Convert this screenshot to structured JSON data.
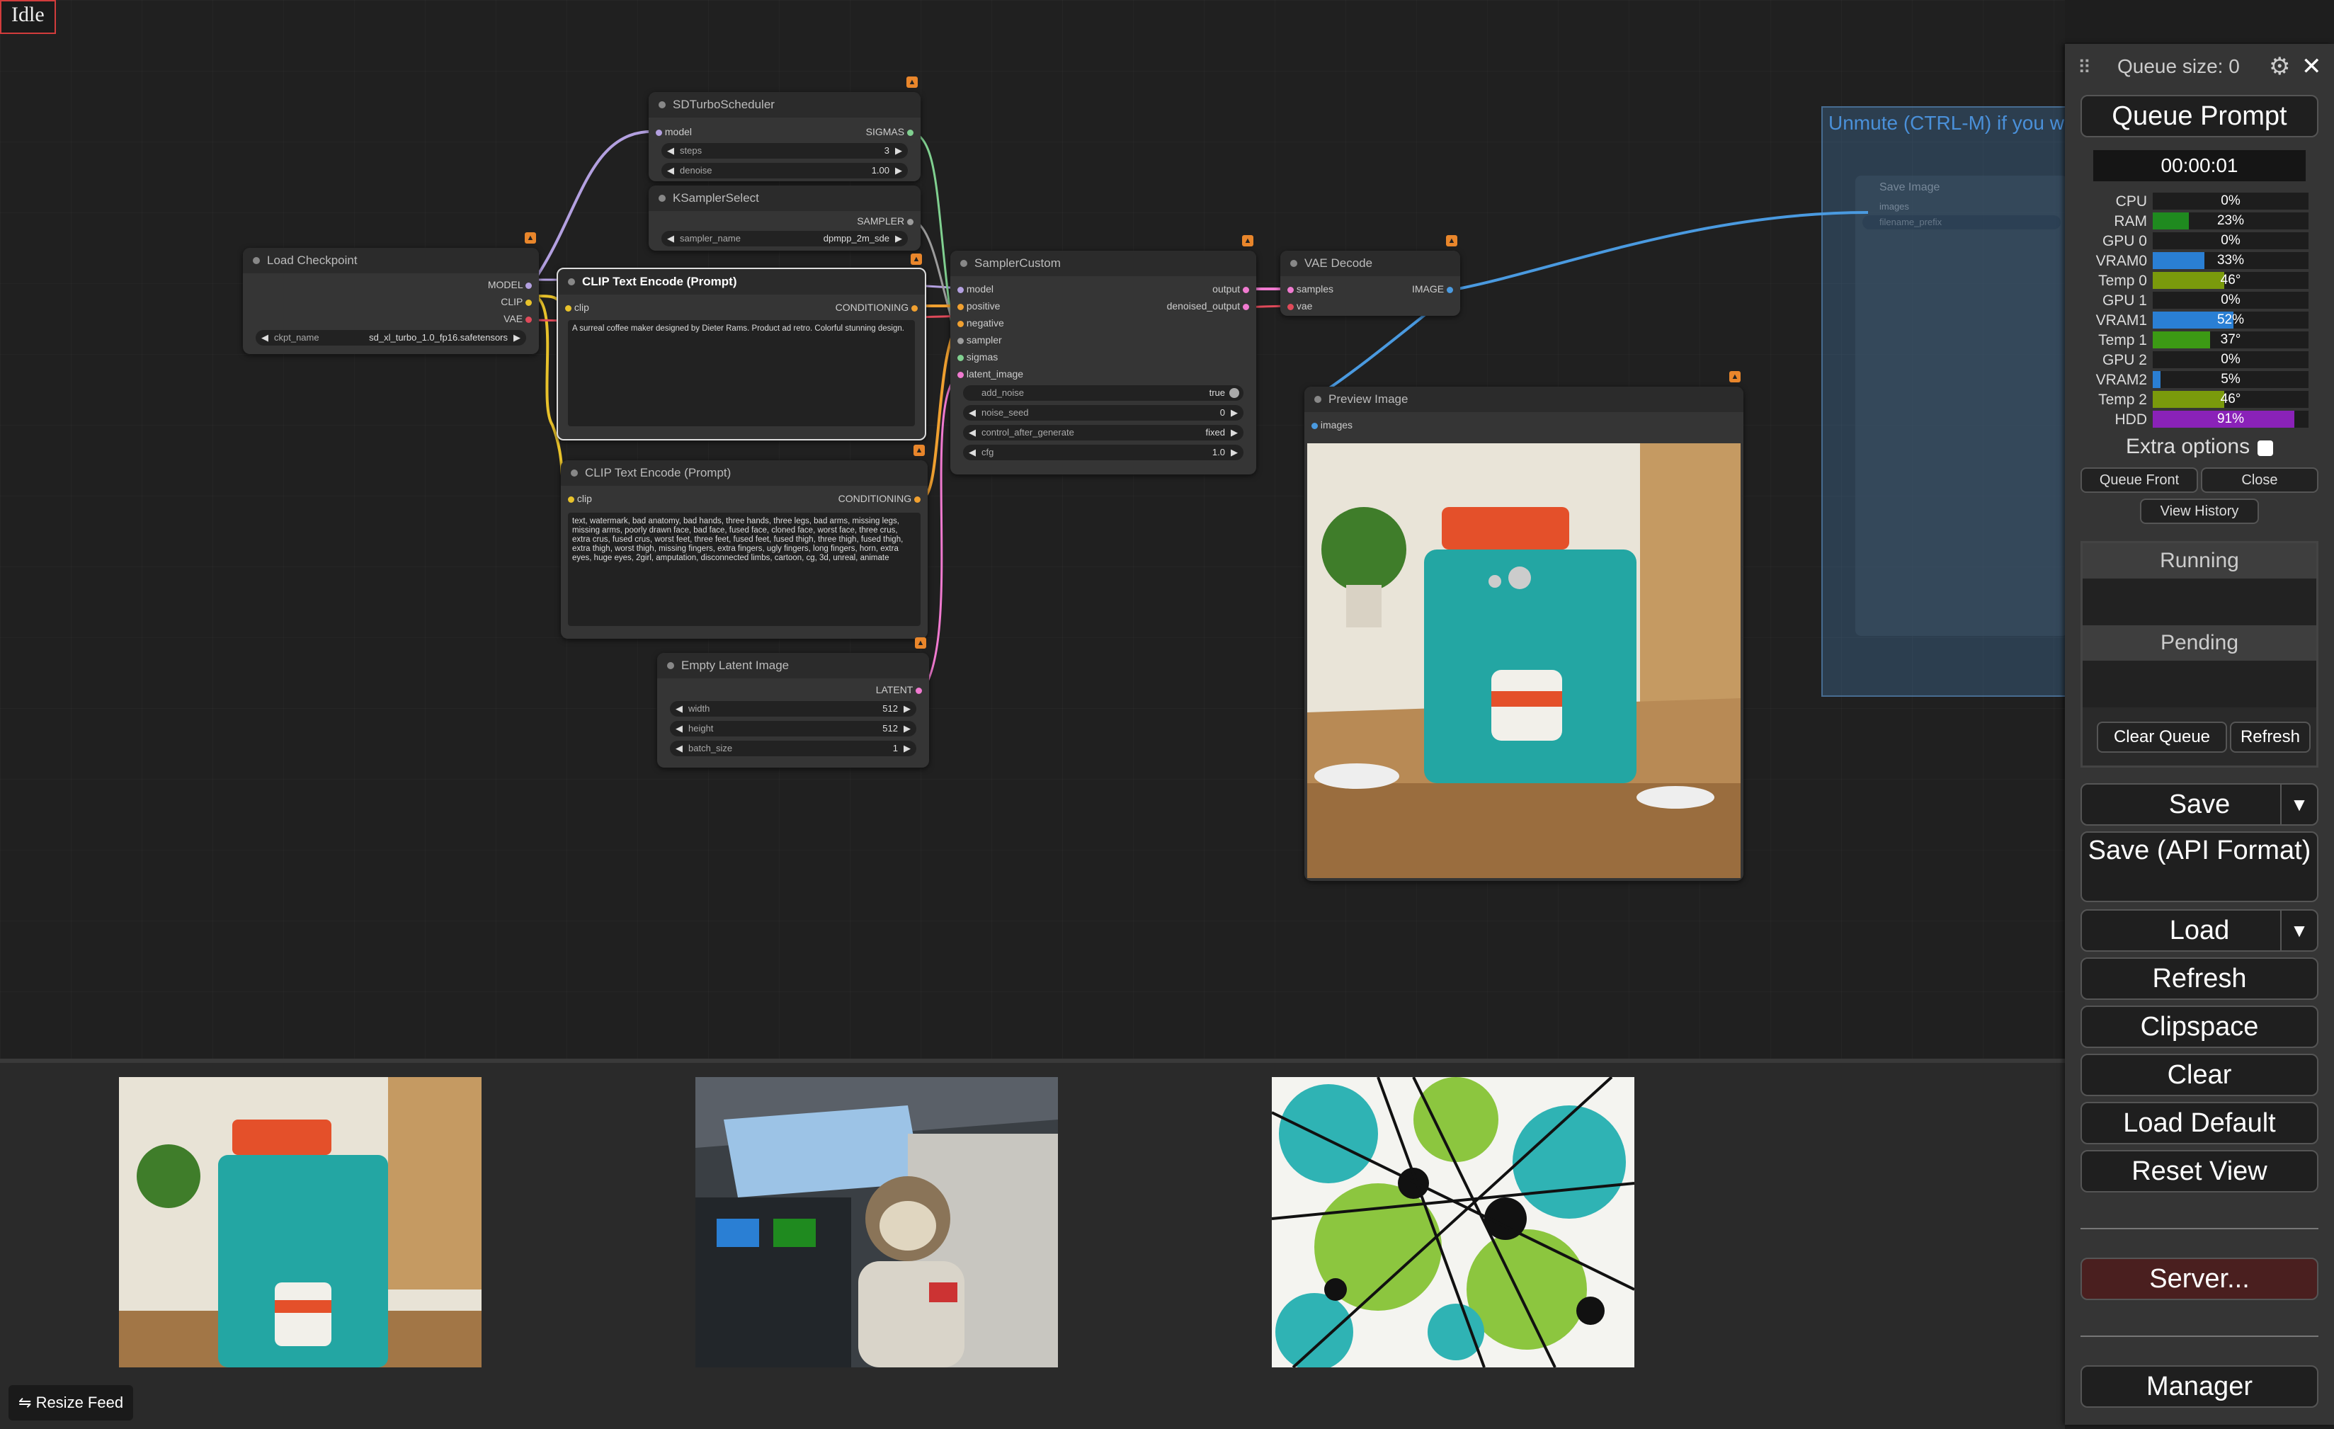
{
  "status": "Idle",
  "graph": {
    "group": {
      "title": "Unmute (CTRL-M) if you w"
    },
    "save_image_node": {
      "title": "Save Image",
      "input": "images",
      "widget": "filename_prefix"
    },
    "load_checkpoint": {
      "title": "Load Checkpoint",
      "outputs": [
        "MODEL",
        "CLIP",
        "VAE"
      ],
      "widget": {
        "label": "ckpt_name",
        "value": "sd_xl_turbo_1.0_fp16.safetensors"
      }
    },
    "sd_turbo_scheduler": {
      "title": "SDTurboScheduler",
      "input": "model",
      "output": "SIGMAS",
      "widgets": [
        {
          "label": "steps",
          "value": "3"
        },
        {
          "label": "denoise",
          "value": "1.00"
        }
      ]
    },
    "ksampler_select": {
      "title": "KSamplerSelect",
      "output": "SAMPLER",
      "widget": {
        "label": "sampler_name",
        "value": "dpmpp_2m_sde"
      }
    },
    "clip_text_pos": {
      "title": "CLIP Text Encode (Prompt)",
      "input": "clip",
      "output": "CONDITIONING",
      "text": "A surreal coffee maker designed by Dieter Rams. Product ad retro. Colorful stunning design."
    },
    "clip_text_neg": {
      "title": "CLIP Text Encode (Prompt)",
      "input": "clip",
      "output": "CONDITIONING",
      "text": "text, watermark, bad anatomy, bad hands, three hands, three legs, bad arms, missing legs, missing arms, poorly drawn face, bad face, fused face, cloned face, worst face, three crus, extra crus, fused crus, worst feet, three feet, fused feet, fused thigh, three thigh, fused thigh, extra thigh, worst thigh, missing fingers, extra fingers, ugly fingers, long fingers, horn, extra eyes, huge eyes, 2girl, amputation, disconnected limbs, cartoon, cg, 3d, unreal, animate"
    },
    "empty_latent": {
      "title": "Empty Latent Image",
      "output": "LATENT",
      "widgets": [
        {
          "label": "width",
          "value": "512"
        },
        {
          "label": "height",
          "value": "512"
        },
        {
          "label": "batch_size",
          "value": "1"
        }
      ]
    },
    "sampler_custom": {
      "title": "SamplerCustom",
      "inputs": [
        "model",
        "positive",
        "negative",
        "sampler",
        "sigmas",
        "latent_image"
      ],
      "outputs": [
        "output",
        "denoised_output"
      ],
      "widgets": [
        {
          "label": "add_noise",
          "value": "true"
        },
        {
          "label": "noise_seed",
          "value": "0"
        },
        {
          "label": "control_after_generate",
          "value": "fixed"
        },
        {
          "label": "cfg",
          "value": "1.0"
        }
      ]
    },
    "vae_decode": {
      "title": "VAE Decode",
      "inputs": [
        "samples",
        "vae"
      ],
      "output": "IMAGE"
    },
    "preview_image": {
      "title": "Preview Image",
      "input": "images"
    }
  },
  "feed": {
    "resize_label": "Resize Feed",
    "thumbs": [
      "coffee maker image",
      "sloth pilot image",
      "paint splatter image"
    ]
  },
  "menu": {
    "queue_size": "Queue size: 0",
    "queue_prompt": "Queue Prompt",
    "timer": "00:00:01",
    "stats": [
      {
        "label": "CPU",
        "value": "0%",
        "fill": 0,
        "color": "#2a7fd4"
      },
      {
        "label": "RAM",
        "value": "23%",
        "fill": 23,
        "color": "#1f8a1f"
      },
      {
        "label": "GPU 0",
        "value": "0%",
        "fill": 0,
        "color": "#2a7fd4"
      },
      {
        "label": "VRAM0",
        "value": "33%",
        "fill": 33,
        "color": "#2a7fd4"
      },
      {
        "label": "Temp 0",
        "value": "46°",
        "fill": 46,
        "color": "#7a9a0c"
      },
      {
        "label": "GPU 1",
        "value": "0%",
        "fill": 0,
        "color": "#2a7fd4"
      },
      {
        "label": "VRAM1",
        "value": "52%",
        "fill": 52,
        "color": "#2a7fd4"
      },
      {
        "label": "Temp 1",
        "value": "37°",
        "fill": 37,
        "color": "#3c9a14"
      },
      {
        "label": "GPU 2",
        "value": "0%",
        "fill": 0,
        "color": "#2a7fd4"
      },
      {
        "label": "VRAM2",
        "value": "5%",
        "fill": 5,
        "color": "#2a7fd4"
      },
      {
        "label": "Temp 2",
        "value": "46°",
        "fill": 46,
        "color": "#7a9a0c"
      },
      {
        "label": "HDD",
        "value": "91%",
        "fill": 91,
        "color": "#8a22b8"
      }
    ],
    "extra_options": "Extra options",
    "queue_front": "Queue Front",
    "close": "Close",
    "view_history": "View History",
    "running": "Running",
    "pending": "Pending",
    "clear_queue": "Clear Queue",
    "refresh_queue": "Refresh",
    "save": "Save",
    "save_api": "Save (API Format)",
    "load": "Load",
    "refresh": "Refresh",
    "clipspace": "Clipspace",
    "clear": "Clear",
    "load_default": "Load Default",
    "reset_view": "Reset View",
    "server": "Server...",
    "manager": "Manager"
  }
}
